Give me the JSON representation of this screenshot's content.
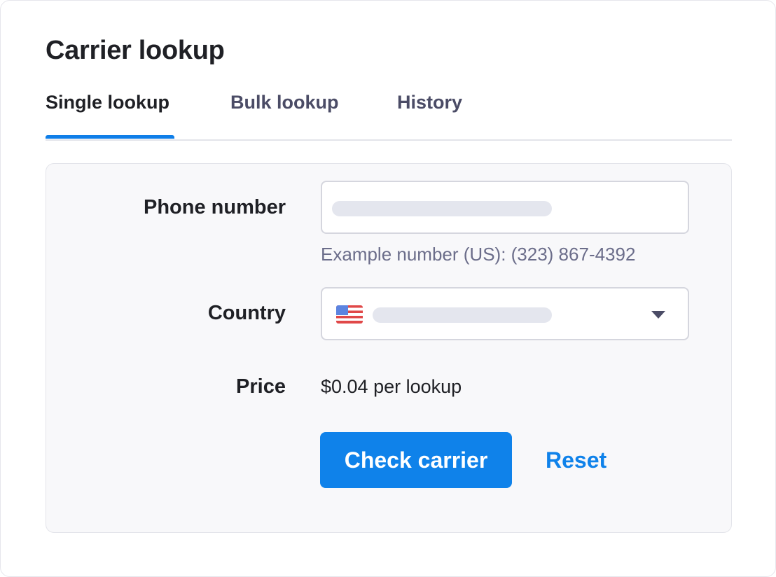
{
  "title": "Carrier lookup",
  "tabs": [
    {
      "label": "Single lookup",
      "active": true
    },
    {
      "label": "Bulk lookup",
      "active": false
    },
    {
      "label": "History",
      "active": false
    }
  ],
  "form": {
    "phone": {
      "label": "Phone number",
      "value": "",
      "hint": "Example number (US): (323) 867-4392"
    },
    "country": {
      "label": "Country",
      "flag_icon": "us-flag-icon",
      "selected": ""
    },
    "price": {
      "label": "Price",
      "value": "$0.04 per lookup"
    }
  },
  "actions": {
    "submit_label": "Check carrier",
    "reset_label": "Reset"
  },
  "colors": {
    "accent": "#0f82ea",
    "text": "#1f2025",
    "muted": "#6b6d8a",
    "panel_bg": "#f8f8fa"
  }
}
